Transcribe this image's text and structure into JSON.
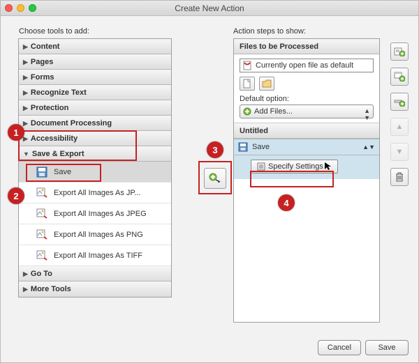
{
  "window": {
    "title": "Create New Action"
  },
  "left": {
    "label": "Choose tools to add:",
    "groups": {
      "content": "Content",
      "pages": "Pages",
      "forms": "Forms",
      "recognize": "Recognize Text",
      "protection": "Protection",
      "docproc": "Document Processing",
      "accessibility": "Accessibility",
      "saveexport": "Save & Export",
      "goto": "Go To",
      "moretools": "More Tools"
    },
    "save_items": {
      "save": "Save",
      "jp": "Export All Images As JP...",
      "jpeg": "Export All Images As JPEG",
      "png": "Export All Images As PNG",
      "tiff": "Export All Images As TIFF"
    }
  },
  "right": {
    "label": "Action steps to show:",
    "files_header": "Files to be Processed",
    "open_file": "Currently open file as default",
    "default_label": "Default option:",
    "default_value": "Add Files...",
    "untitled": "Untitled",
    "save": "Save",
    "specify": "Specify Settings"
  },
  "footer": {
    "cancel": "Cancel",
    "save": "Save"
  },
  "badges": {
    "b1": "1",
    "b2": "2",
    "b3": "3",
    "b4": "4"
  }
}
